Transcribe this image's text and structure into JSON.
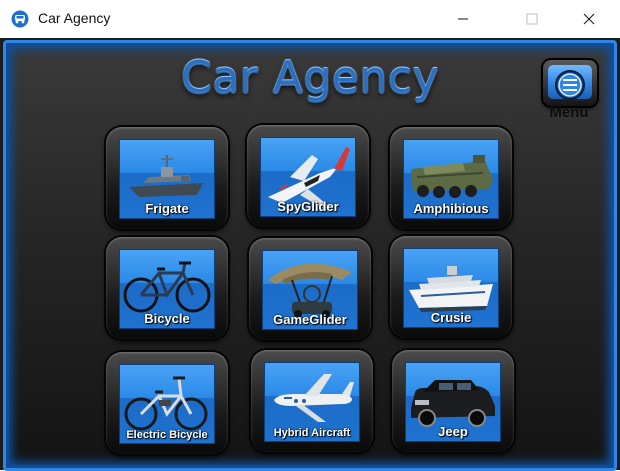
{
  "window": {
    "title": "Car Agency"
  },
  "app": {
    "heading": "Car Agency",
    "menu_label": "Menu"
  },
  "tiles": [
    {
      "label": "Frigate",
      "icon": "frigate-icon"
    },
    {
      "label": "SpyGlider",
      "icon": "glider-icon"
    },
    {
      "label": "Amphibious",
      "icon": "amphibious-vehicle-icon"
    },
    {
      "label": "Bicycle",
      "icon": "bicycle-icon"
    },
    {
      "label": "GameGlider",
      "icon": "game-glider-icon"
    },
    {
      "label": "Crusie",
      "icon": "cruise-ship-icon"
    },
    {
      "label": "Electric Bicycle",
      "icon": "electric-bicycle-icon"
    },
    {
      "label": "Hybrid Aircraft",
      "icon": "hybrid-aircraft-icon"
    },
    {
      "label": "Jeep",
      "icon": "jeep-icon"
    }
  ],
  "colors": {
    "accent": "#2f86e4",
    "title": "#2d6fbe",
    "background": "#1c1c1c"
  }
}
